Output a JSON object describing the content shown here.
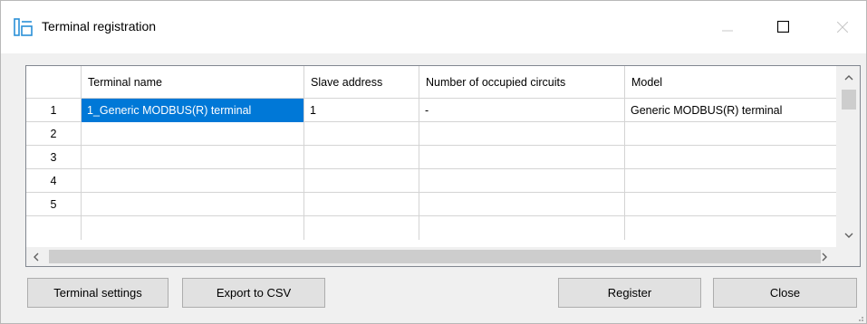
{
  "window": {
    "title": "Terminal registration"
  },
  "grid": {
    "columns": [
      "Terminal name",
      "Slave address",
      "Number of occupied circuits",
      "Model"
    ],
    "rows": [
      {
        "num": "1",
        "cells": [
          "1_Generic MODBUS(R) terminal",
          "1",
          "-",
          "Generic MODBUS(R) terminal"
        ]
      },
      {
        "num": "2",
        "cells": [
          "",
          "",
          "",
          ""
        ]
      },
      {
        "num": "3",
        "cells": [
          "",
          "",
          "",
          ""
        ]
      },
      {
        "num": "4",
        "cells": [
          "",
          "",
          "",
          ""
        ]
      },
      {
        "num": "5",
        "cells": [
          "",
          "",
          "",
          ""
        ]
      }
    ]
  },
  "buttons": {
    "terminal_settings": "Terminal settings",
    "export_csv": "Export to CSV",
    "register": "Register",
    "close": "Close"
  },
  "colors": {
    "selection": "#0078d7",
    "accent": "#2a8fd7"
  },
  "icons": [
    "app-icon",
    "minimize-icon",
    "maximize-icon",
    "close-icon",
    "scroll-up-arrow-icon",
    "scroll-down-arrow-icon",
    "scroll-left-arrow-icon",
    "scroll-right-arrow-icon",
    "resize-grip-icon"
  ]
}
